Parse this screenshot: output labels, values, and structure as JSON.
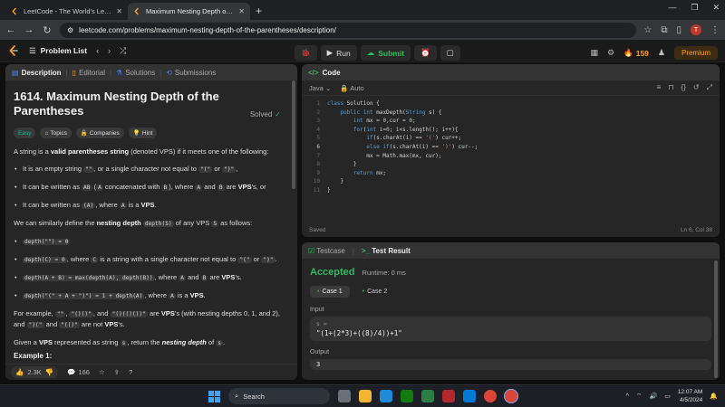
{
  "browser": {
    "tabs": [
      {
        "title": "LeetCode - The World's Leadin",
        "active": false
      },
      {
        "title": "Maximum Nesting Depth of the",
        "active": true
      }
    ],
    "url": "leetcode.com/problems/maximum-nesting-depth-of-the-parentheses/description/",
    "profile_initial": "T"
  },
  "header": {
    "problem_list": "Problem List",
    "run": "Run",
    "submit": "Submit",
    "streak": "159",
    "premium": "Premium"
  },
  "left": {
    "tabs": [
      "Description",
      "Editorial",
      "Solutions",
      "Submissions"
    ],
    "title": "1614. Maximum Nesting Depth of the Parentheses",
    "solved": "Solved",
    "chips": [
      "Easy",
      "Topics",
      "Companies",
      "Hint"
    ],
    "intro_pre": "A string is a ",
    "intro_bold": "valid parentheses string",
    "intro_post": " (denoted VPS) if it meets one of the following:",
    "b1_pre": "It is an empty string ",
    "b1_code": "\"\"",
    "b1_mid": ", or a single character not equal to ",
    "b1_code2": "\"(\"",
    "b1_or": " or ",
    "b1_code3": "\")\"",
    "b1_end": ",",
    "b2_pre": "It can be written as ",
    "b2_code": "AB",
    "b2_a": " (",
    "b2_code2": "A",
    "b2_b": " concatenated with ",
    "b2_code3": "B",
    "b2_c": "), where ",
    "b2_code4": "A",
    "b2_d": " and ",
    "b2_code5": "B",
    "b2_e": " are ",
    "b2_bold": "VPS",
    "b2_f": "'s, or",
    "b3_pre": "It can be written as ",
    "b3_code": "(A)",
    "b3_mid": ", where ",
    "b3_code2": "A",
    "b3_mid2": " is a ",
    "b3_bold": "VPS",
    "b3_end": ".",
    "para2_pre": "We can similarly define the ",
    "para2_bold": "nesting depth",
    "para2_code": "depth(S)",
    "para2_mid": " of any VPS ",
    "para2_code2": "S",
    "para2_end": " as follows:",
    "d1_code": "depth(\"\") = 0",
    "d2_code": "depth(C) = 0",
    "d2_mid": ", where ",
    "d2_code2": "C",
    "d2_text": " is a string with a single character not equal to ",
    "d2_code3": "\"(\"",
    "d2_or": " or ",
    "d2_code4": "\")\"",
    "d2_end": ".",
    "d3_code": "depth(A + B) = max(depth(A), depth(B))",
    "d3_mid": ", where ",
    "d3_code2": "A",
    "d3_and": " and ",
    "d3_code3": "B",
    "d3_are": " are ",
    "d3_bold": "VPS",
    "d3_end": "'s.",
    "d4_code": "depth(\"(\" + A + \")\") = 1 + depth(A)",
    "d4_mid": ", where ",
    "d4_code2": "A",
    "d4_is": " is a ",
    "d4_bold": "VPS",
    "d4_end": ".",
    "ex_pre": "For example, ",
    "ex_c1": "\"\"",
    "ex_s1": ", ",
    "ex_c2": "\"()()\"",
    "ex_s2": ", and ",
    "ex_c3": "\"()(()())\"",
    "ex_s3": " are ",
    "ex_bold1": "VPS",
    "ex_s4": "'s (with nesting depths 0, 1, and 2), and ",
    "ex_c4": "\")(\"",
    "ex_s5": " and ",
    "ex_c5": "\"(()\"",
    "ex_s6": " are not ",
    "ex_bold2": "VPS",
    "ex_s7": "'s.",
    "final_pre": "Given a ",
    "final_bold": "VPS",
    "final_mid": " represented as string ",
    "final_code": "s",
    "final_mid2": ", return the ",
    "final_bold2": "nesting depth",
    "final_of": " of ",
    "final_code2": "s",
    "final_end": ".",
    "example_head": "Example 1:",
    "likes": "2.3K",
    "comments": "166"
  },
  "code": {
    "title": "Code",
    "language": "Java",
    "mode": "Auto",
    "line_numbers": [
      "1",
      "2",
      "3",
      "4",
      "5",
      "6",
      "7",
      "8",
      "9",
      "10",
      "11"
    ],
    "lines": [
      "class Solution {",
      "    public int maxDepth(String s) {",
      "        int mx = 0,cur = 0;",
      "        for(int i=0; i<s.length(); i++){",
      "            if(s.charAt(i) == '(') cur++;",
      "            else if(s.charAt(i) == ')') cur--;",
      "            mx = Math.max(mx, cur);",
      "        }",
      "        return mx;",
      "    }",
      "}"
    ],
    "status_left": "Saved",
    "status_right": "Ln 6, Col 38"
  },
  "test": {
    "tabs": [
      "Testcase",
      "Test Result"
    ],
    "result": "Accepted",
    "runtime": "Runtime: 0 ms",
    "cases": [
      "Case 1",
      "Case 2"
    ],
    "input_label": "Input",
    "input_var": "s =",
    "input_value": "\"(1+(2*3)+((8)/4))+1\"",
    "output_label": "Output",
    "output_value": "3"
  },
  "taskbar": {
    "search": "Search",
    "time": "12:07 AM",
    "date": "4/5/2024"
  },
  "colors": {
    "accepted": "#2cbb5d",
    "easy": "#00b8a3",
    "brand": "#ffa116"
  }
}
